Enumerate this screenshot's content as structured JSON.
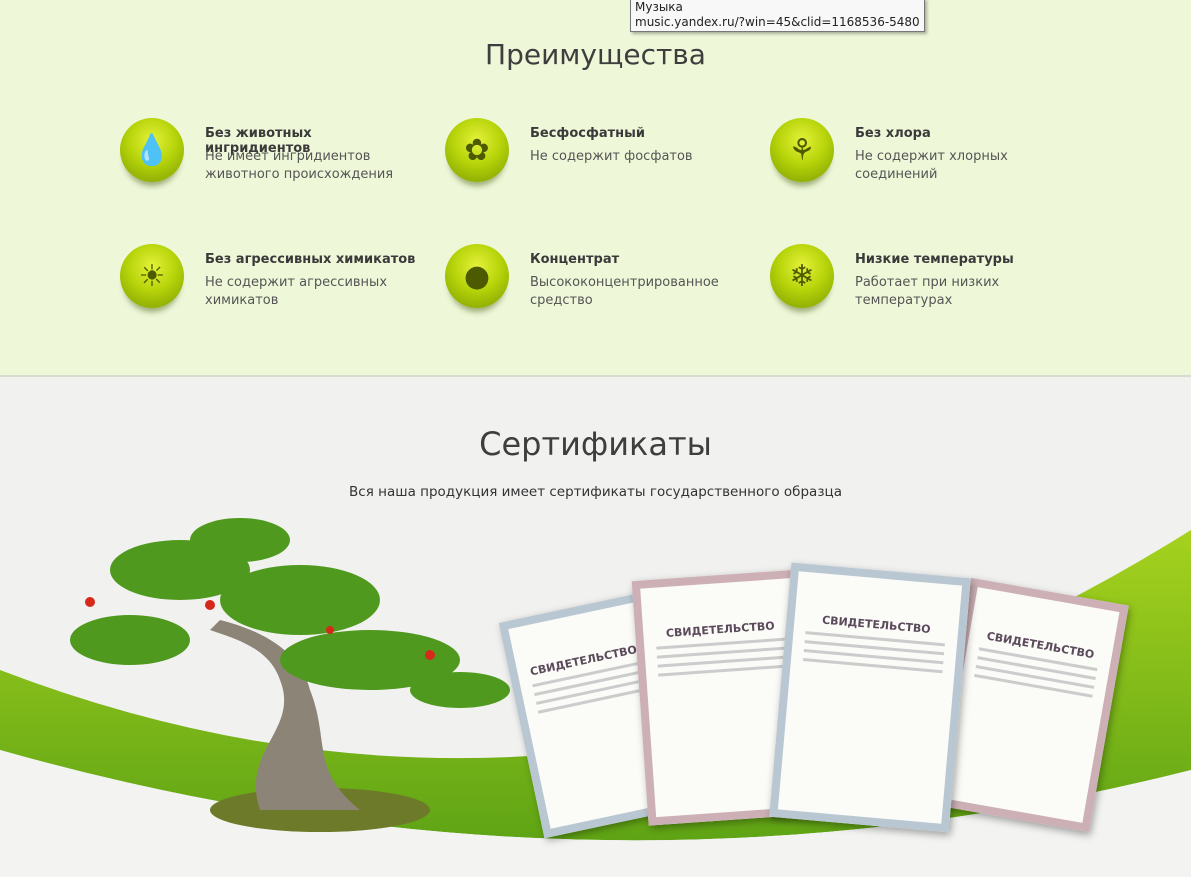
{
  "tooltip": {
    "title": "Музыка",
    "url": "music.yandex.ru/?win=45&clid=1168536-5480"
  },
  "advantages": {
    "title": "Преимущества",
    "items": [
      {
        "title": "Без животных ингридиентов",
        "desc": "Не имеет ингридиентов животного происхождения",
        "icon": "drop-face-icon",
        "glyph": "💧"
      },
      {
        "title": "Бесфосфатный",
        "desc": "Не содержит фосфатов",
        "icon": "flower-icon",
        "glyph": "✿"
      },
      {
        "title": "Без хлора",
        "desc": "Не содержит хлорных соединений",
        "icon": "tulip-icon",
        "glyph": "⚘"
      },
      {
        "title": "Без агрессивных химикатов",
        "desc": "Не содержит агрессивных химикатов",
        "icon": "sun-icon",
        "glyph": "☀"
      },
      {
        "title": "Концентрат",
        "desc": "Высококонцентрированное средство",
        "icon": "drop-icon",
        "glyph": "●"
      },
      {
        "title": "Низкие температуры",
        "desc": "Работает при низких температурах",
        "icon": "snowflakes-icon",
        "glyph": "❄"
      }
    ]
  },
  "certificates": {
    "title": "Сертификаты",
    "subtitle": "Вся наша продукция имеет сертификаты государственного образца",
    "cert_heading": "СВИДЕТЕЛЬСТВО"
  },
  "colors": {
    "accent": "#8cc21a",
    "bg_top": "#eef8d9"
  }
}
